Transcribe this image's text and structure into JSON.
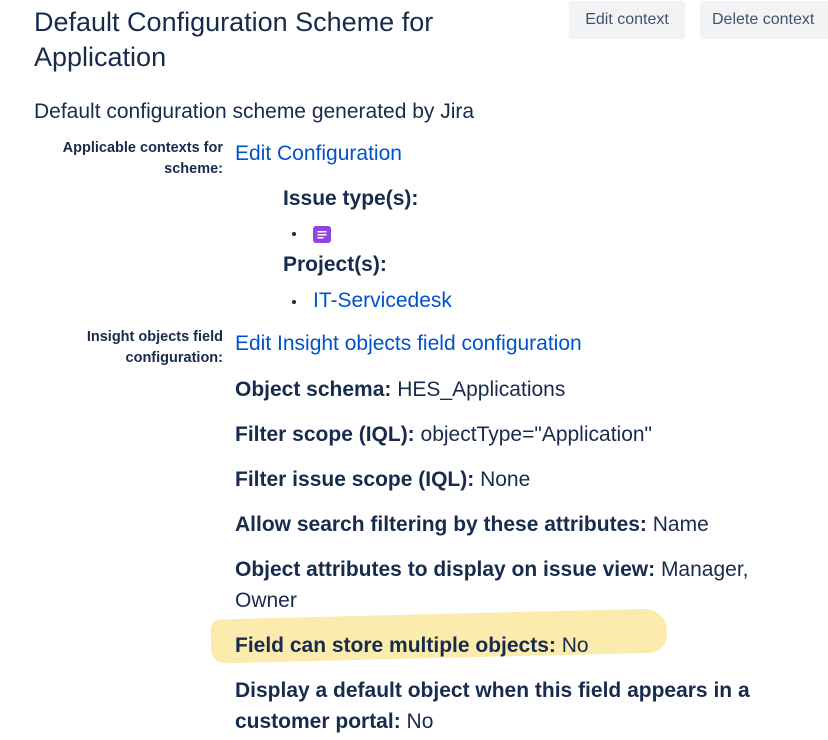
{
  "header": {
    "title": "Default Configuration Scheme for Application",
    "edit_context_label": "Edit context",
    "delete_context_label": "Delete context"
  },
  "description": "Default configuration scheme generated by Jira",
  "contexts": {
    "label": "Applicable contexts for scheme:",
    "edit_link": "Edit Configuration",
    "issue_types_heading": "Issue type(s):",
    "issue_type_icon": "issue-type-icon",
    "projects_heading": "Project(s):",
    "projects": [
      "IT-Servicedesk"
    ]
  },
  "insight": {
    "label": "Insight objects field configuration:",
    "edit_link": "Edit Insight objects field configuration",
    "properties": [
      {
        "key": "Object schema:",
        "value": "HES_Applications"
      },
      {
        "key": "Filter scope (IQL):",
        "value": "objectType=\"Application\""
      },
      {
        "key": "Filter issue scope (IQL):",
        "value": "None"
      },
      {
        "key": "Allow search filtering by these attributes:",
        "value": "Name"
      },
      {
        "key": "Object attributes to display on issue view:",
        "value": "Manager, Owner"
      },
      {
        "key": "Field can store multiple objects:",
        "value": "No"
      },
      {
        "key": "Display a default object when this field appears in a customer portal:",
        "value": "No"
      }
    ]
  },
  "colors": {
    "text": "#172b4d",
    "link": "#0052cc",
    "button_bg": "#f2f3f5",
    "issue_icon": "#8f45e0",
    "highlight": "#fbe9a3"
  }
}
